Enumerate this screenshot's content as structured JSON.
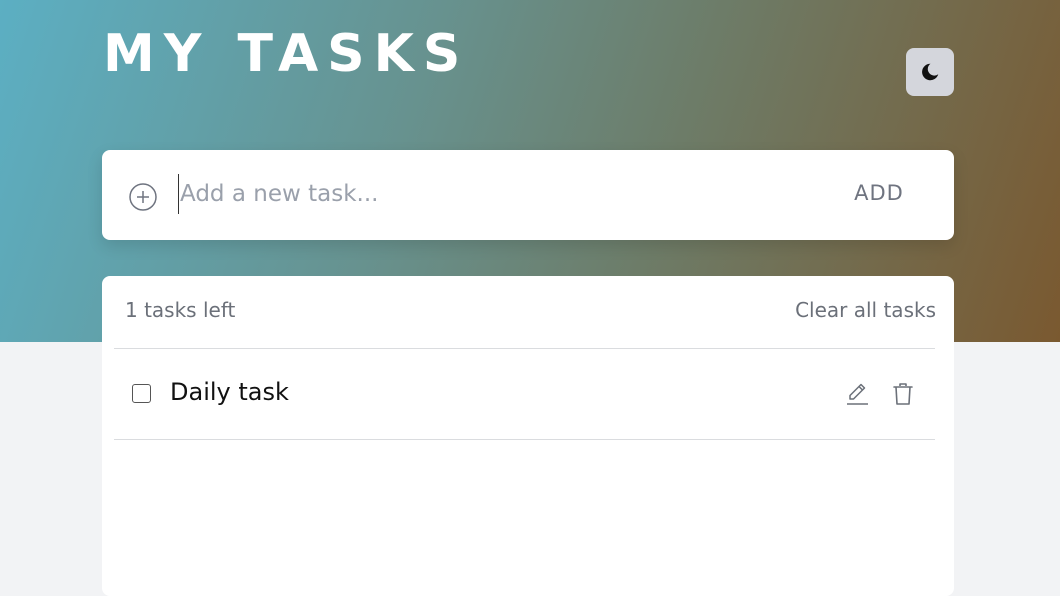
{
  "header": {
    "title": "MY TASKS",
    "theme_toggle_icon": "moon-icon"
  },
  "new_task": {
    "add_icon": "plus-circle-icon",
    "input_value": "",
    "input_placeholder": "Add a new task...",
    "add_label": "ADD"
  },
  "task_list": {
    "tasks_left_text": "1 tasks left",
    "clear_label": "Clear all tasks",
    "items": [
      {
        "text": "Daily task",
        "completed": false,
        "edit_icon": "pencil-icon",
        "delete_icon": "trash-icon"
      }
    ]
  },
  "colors": {
    "gradient_start": "#5cafc3",
    "gradient_end": "#7a5930",
    "page_background": "#f2f3f5",
    "card_background": "#ffffff",
    "theme_button_background": "#d4d6dc"
  }
}
